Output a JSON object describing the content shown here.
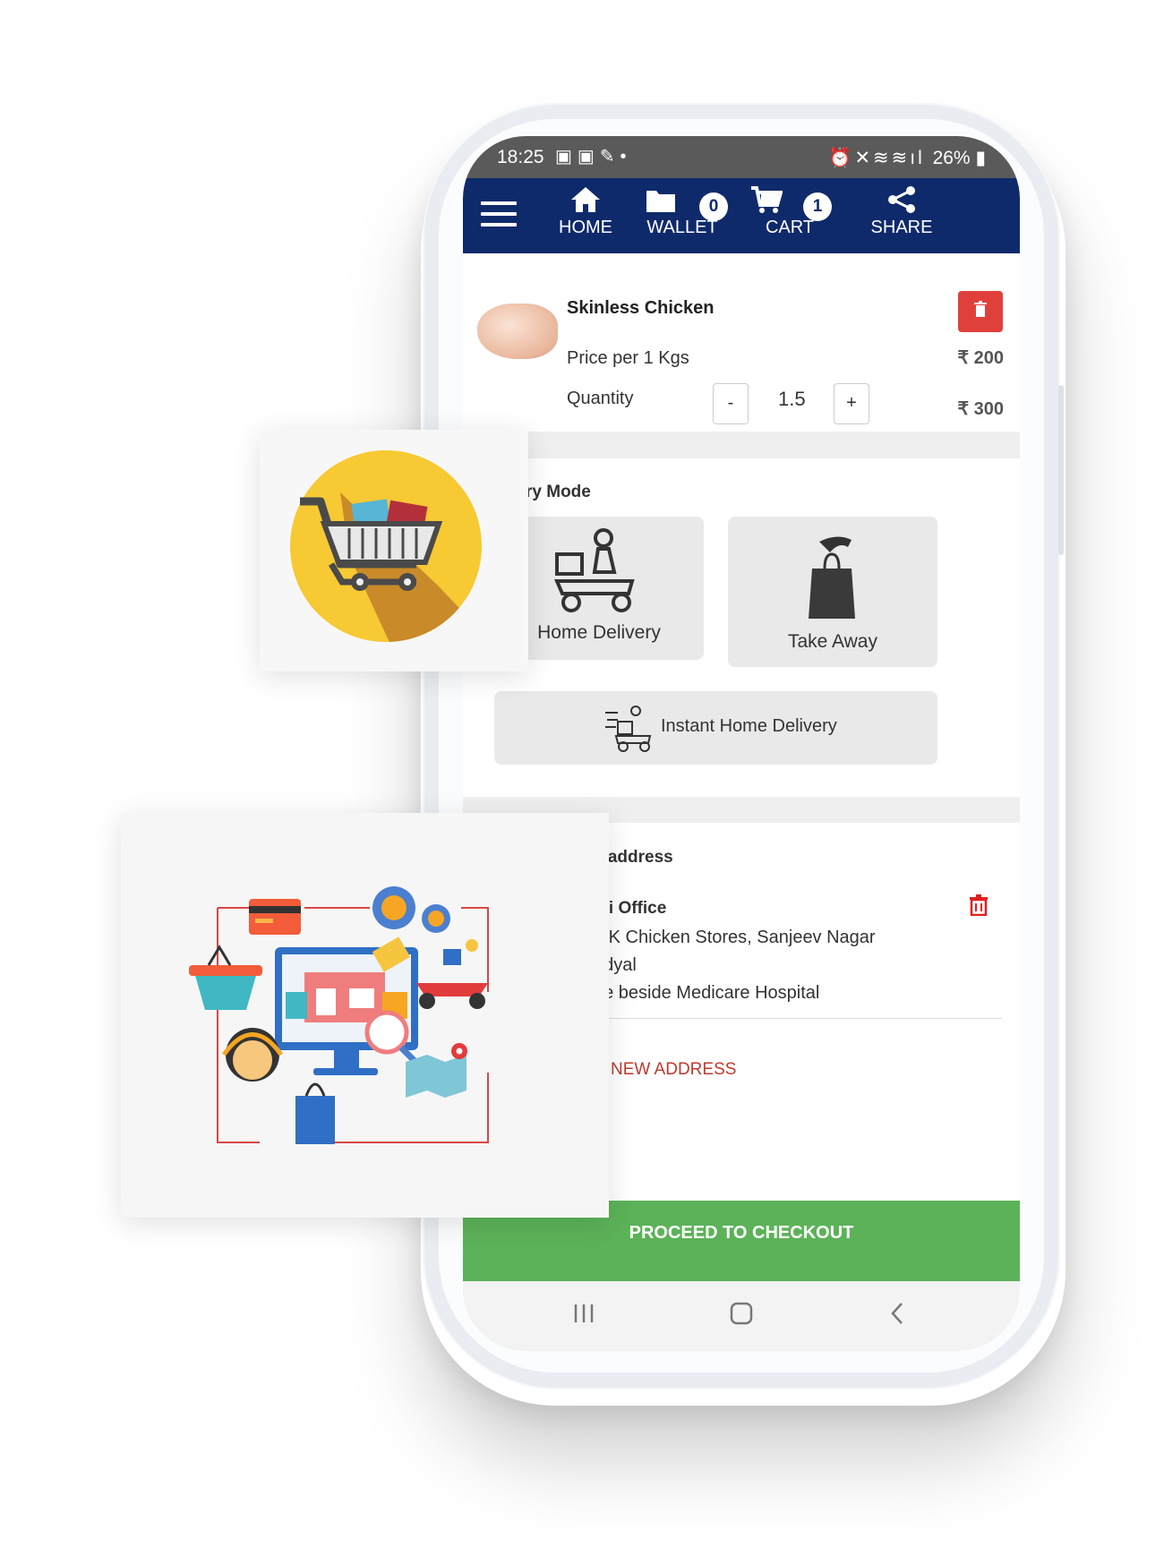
{
  "status_bar": {
    "time": "18:25",
    "right_text": "26%"
  },
  "nav": {
    "items": [
      {
        "label": "HOME"
      },
      {
        "label": "WALLET",
        "badge": "0"
      },
      {
        "label": "CART",
        "badge": "1"
      },
      {
        "label": "SHARE"
      }
    ]
  },
  "cart_item": {
    "name": "Skinless Chicken",
    "price_label": "Price per 1 Kgs",
    "price_value": "₹ 200",
    "quantity_label": "Quantity",
    "quantity_value": "1.5",
    "decrement": "-",
    "increment": "+",
    "total": "₹ 300"
  },
  "delivery": {
    "heading": "ry Mode",
    "home_delivery": "Home Delivery",
    "take_away": "Take Away",
    "instant": "Instant Home Delivery"
  },
  "address": {
    "heading": "y address",
    "name": "uli Office",
    "line1": "MK Chicken Stores, Sanjeev Nagar",
    "line2": "ndyal",
    "line3": "ne beside Medicare Hospital",
    "add_new": "D NEW ADDRESS"
  },
  "checkout": {
    "label": "PROCEED TO CHECKOUT"
  },
  "colors": {
    "navbar": "#0f2a6b",
    "checkout": "#5cb258",
    "delete": "#e0403c",
    "add_address": "#c0392b"
  },
  "icons": [
    "menu-icon",
    "home-icon",
    "wallet-icon",
    "cart-icon",
    "share-icon",
    "trash-icon",
    "scooter-icon",
    "shopping-bag-icon",
    "shopping-cart-icon",
    "ecommerce-illustration"
  ]
}
